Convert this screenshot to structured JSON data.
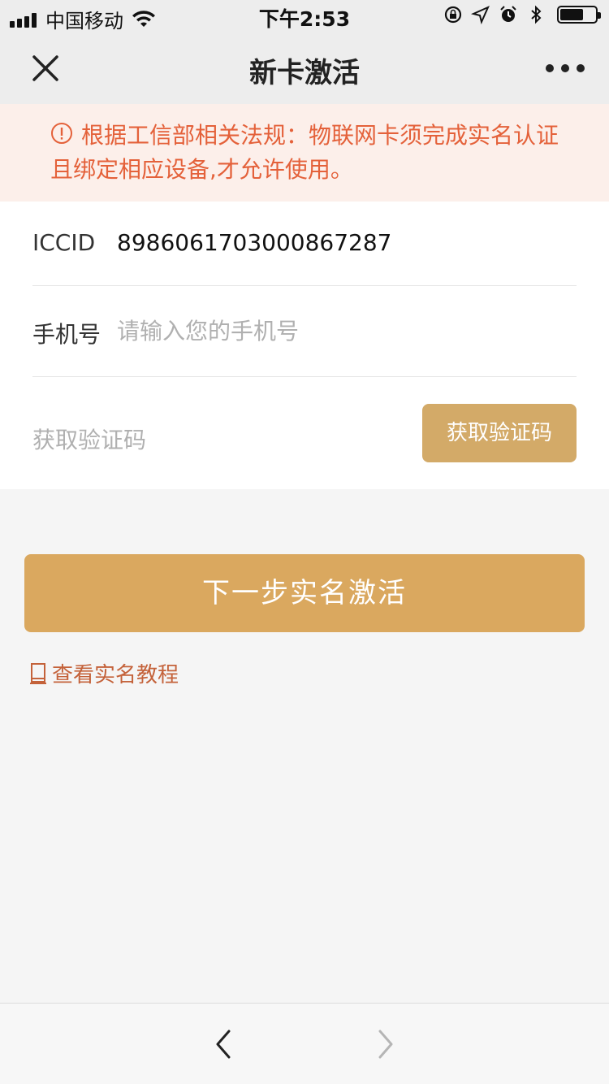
{
  "status_bar": {
    "carrier": "中国移动",
    "time": "下午2:53"
  },
  "nav": {
    "title": "新卡激活",
    "close_icon": "close-icon",
    "more_icon": "more-icon"
  },
  "notice": {
    "icon": "exclamation-circle-icon",
    "text": "根据工信部相关法规：物联网卡须完成实名认证且绑定相应设备,才允许使用。",
    "color": "#e4613a",
    "background": "#fcefea"
  },
  "form": {
    "iccid_label": "ICCID",
    "iccid_value": "89860617030008672​87",
    "phone_label": "手机号",
    "phone_placeholder": "请输入您的手机号",
    "phone_value": "",
    "code_placeholder": "获取验证码",
    "code_value": "",
    "get_code_button": "获取验证码"
  },
  "actions": {
    "next_button": "下一步实名激活",
    "tutorial_link": "查看实名教程",
    "accent_color": "#daa85f",
    "link_color": "#c4623a"
  },
  "toolbar": {
    "back_icon": "chevron-left-icon",
    "forward_icon": "chevron-right-icon"
  }
}
